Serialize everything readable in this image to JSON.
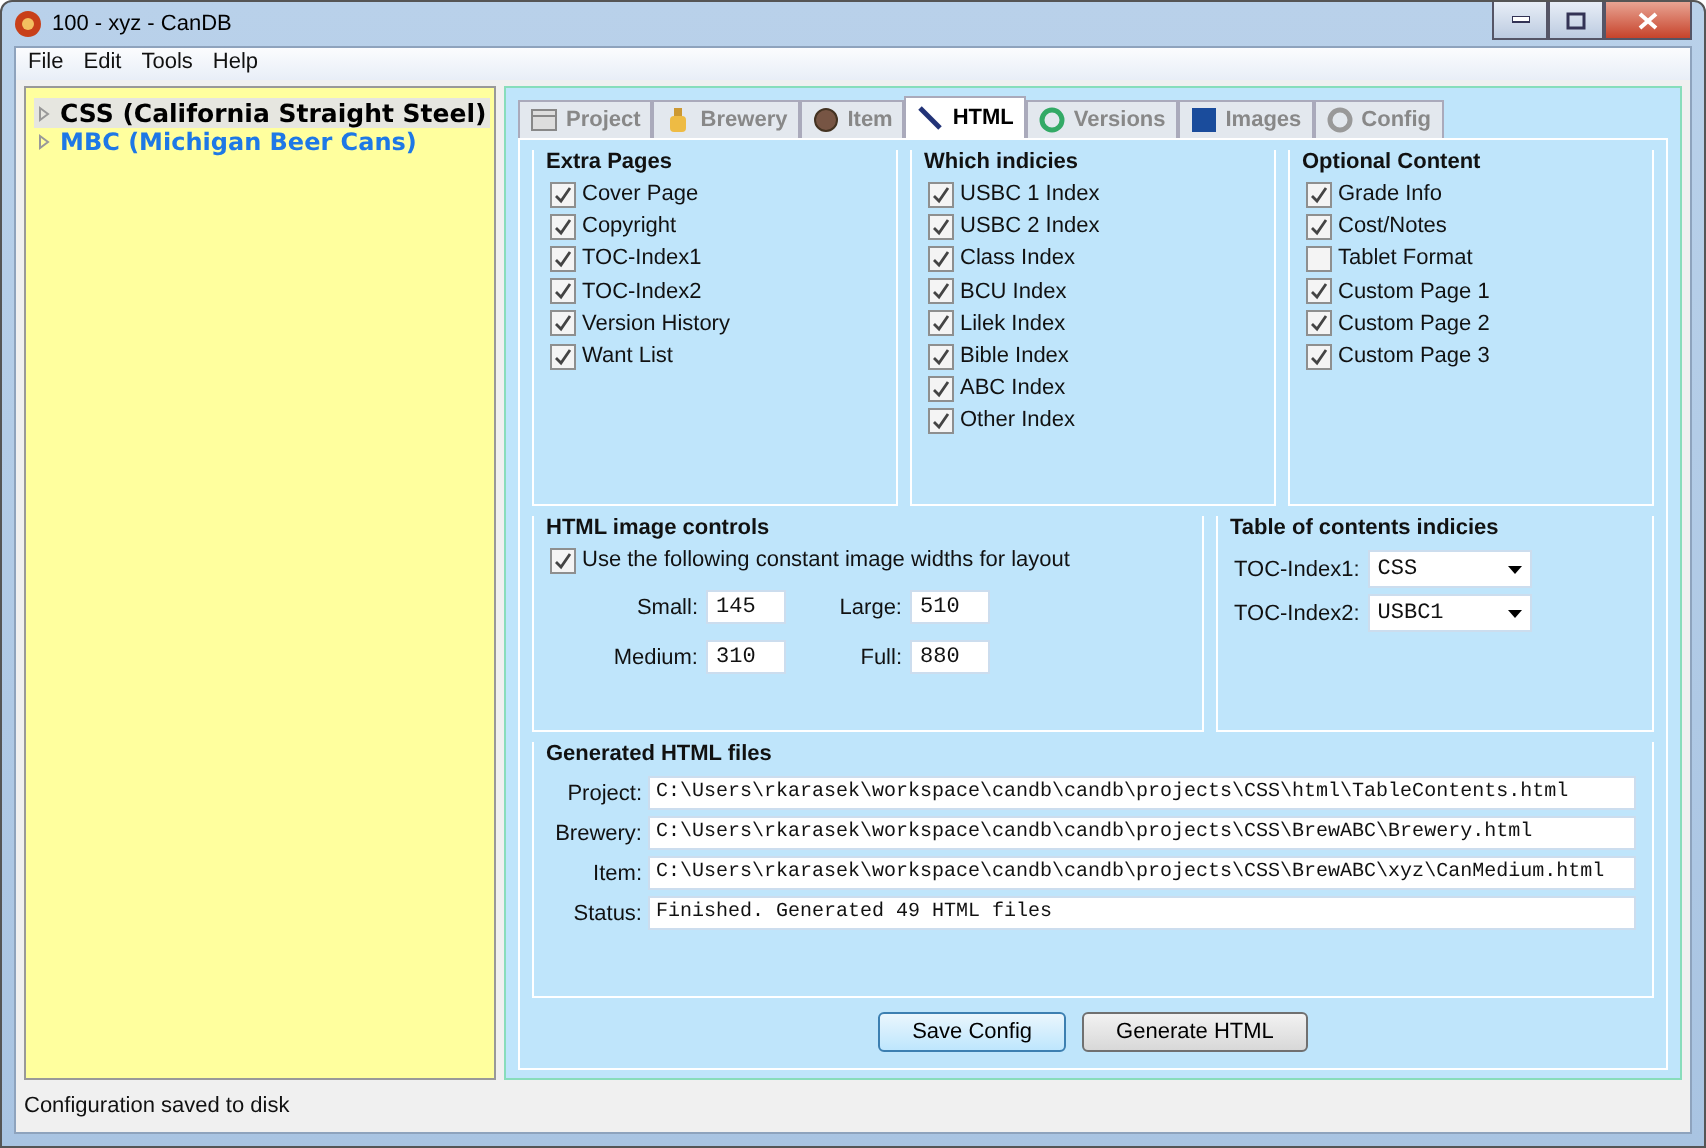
{
  "window": {
    "title": "100 - xyz - CanDB"
  },
  "menu": [
    "File",
    "Edit",
    "Tools",
    "Help"
  ],
  "tree": [
    {
      "label": "CSS (California Straight Steel)",
      "selected": true,
      "color": "#000000"
    },
    {
      "label": "MBC (Michigan Beer Cans)",
      "selected": false,
      "color": "#1e78e6"
    }
  ],
  "tabs": [
    {
      "label": "Project",
      "selected": false
    },
    {
      "label": "Brewery",
      "selected": false
    },
    {
      "label": "Item",
      "selected": false
    },
    {
      "label": "HTML",
      "selected": true
    },
    {
      "label": "Versions",
      "selected": false
    },
    {
      "label": "Images",
      "selected": false
    },
    {
      "label": "Config",
      "selected": false
    }
  ],
  "groups": [
    {
      "title": "Extra Pages",
      "items": [
        {
          "label": "Cover Page",
          "checked": true
        },
        {
          "label": "Copyright",
          "checked": true
        },
        {
          "label": "TOC-Index1",
          "checked": true
        },
        {
          "label": "TOC-Index2",
          "checked": true
        },
        {
          "label": "Version History",
          "checked": true
        },
        {
          "label": "Want List",
          "checked": true
        }
      ]
    },
    {
      "title": "Which indicies",
      "items": [
        {
          "label": "USBC 1 Index",
          "checked": true
        },
        {
          "label": "USBC 2 Index",
          "checked": true
        },
        {
          "label": "Class Index",
          "checked": true
        },
        {
          "label": "BCU Index",
          "checked": true
        },
        {
          "label": "Lilek Index",
          "checked": true
        },
        {
          "label": "Bible Index",
          "checked": true
        },
        {
          "label": "ABC Index",
          "checked": true
        },
        {
          "label": "Other Index",
          "checked": true
        }
      ]
    },
    {
      "title": "Optional Content",
      "items": [
        {
          "label": "Grade Info",
          "checked": true
        },
        {
          "label": "Cost/Notes",
          "checked": true
        },
        {
          "label": "Tablet Format",
          "checked": false
        },
        {
          "label": "Custom Page 1",
          "checked": true
        },
        {
          "label": "Custom Page 2",
          "checked": true
        },
        {
          "label": "Custom Page 3",
          "checked": true
        }
      ]
    }
  ],
  "image_controls": {
    "title": "HTML image controls",
    "use_constant": {
      "label": "Use the following constant image widths for layout",
      "checked": true
    },
    "widths": [
      {
        "label": "Small:",
        "value": "145"
      },
      {
        "label": "Large:",
        "value": "510"
      },
      {
        "label": "Medium:",
        "value": "310"
      },
      {
        "label": "Full:",
        "value": "880"
      }
    ]
  },
  "toc": {
    "title": "Table of contents indicies",
    "selects": [
      {
        "label": "TOC-Index1:",
        "value": "CSS"
      },
      {
        "label": "TOC-Index2:",
        "value": "USBC1"
      }
    ]
  },
  "generated": {
    "title": "Generated HTML files",
    "rows": [
      {
        "label": "Project:",
        "value": "C:\\Users\\rkarasek\\workspace\\candb\\candb\\projects\\CSS\\html\\TableContents.html"
      },
      {
        "label": "Brewery:",
        "value": "C:\\Users\\rkarasek\\workspace\\candb\\candb\\projects\\CSS\\BrewABC\\Brewery.html"
      },
      {
        "label": "Item:",
        "value": "C:\\Users\\rkarasek\\workspace\\candb\\candb\\projects\\CSS\\BrewABC\\xyz\\CanMedium.html"
      },
      {
        "label": "Status:",
        "value": "Finished. Generated 49 HTML files"
      }
    ]
  },
  "buttons": [
    {
      "label": "Save Config",
      "selected": true
    },
    {
      "label": "Generate HTML",
      "selected": false
    }
  ],
  "status_bar": "Configuration saved to disk"
}
